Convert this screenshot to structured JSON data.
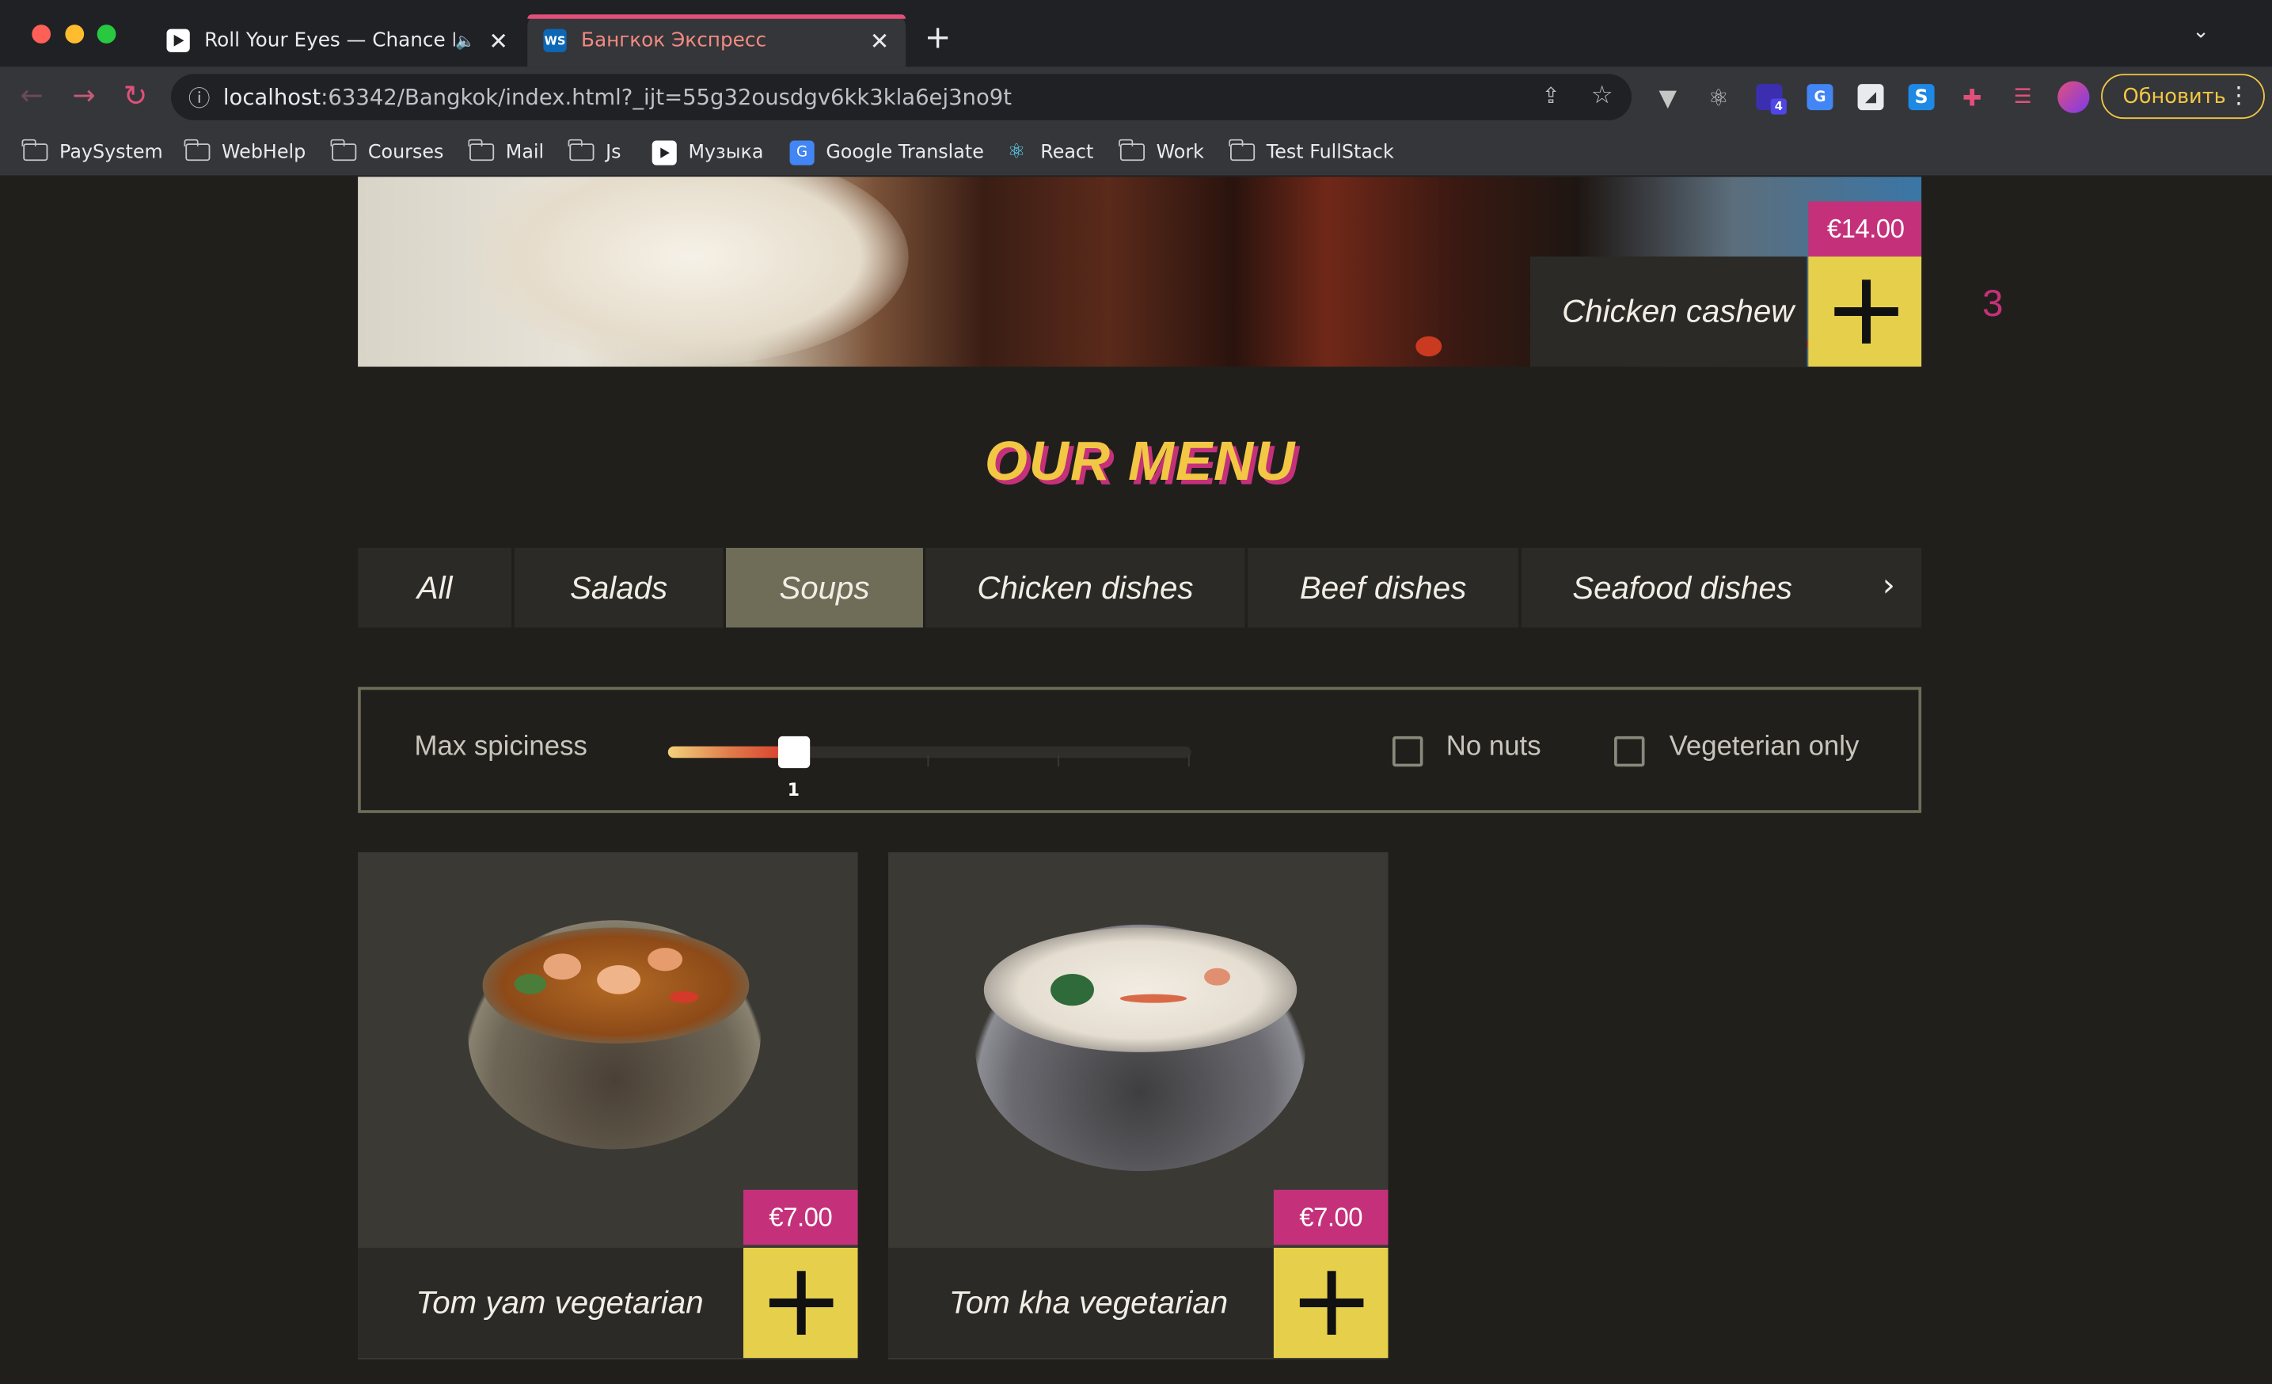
{
  "browser": {
    "tabs": [
      {
        "title": "Roll Your Eyes — Chance P",
        "favicon": "play-icon",
        "audio_icon": "🔈",
        "close": "✕"
      },
      {
        "title": "Бангкок Экспресс",
        "favicon": "webstorm-icon",
        "close": "✕",
        "active": true
      }
    ],
    "new_tab": "+",
    "tabs_dropdown": "⌄",
    "nav": {
      "back": "←",
      "forward": "→",
      "reload": "↻"
    },
    "url": {
      "host": "localhost",
      "rest": ":63342/Bangkok/index.html?_ijt=55g32ousdgv6kk3kla6ej3no9t"
    },
    "omnibox_icons": {
      "info": "ⓘ",
      "share": "⇪",
      "star": "☆"
    },
    "extensions": [
      "vue-devtools-icon",
      "react-devtools-icon",
      "stack-icon",
      "google-translate-icon",
      "eraser-icon",
      "s-extension-icon",
      "puzzle-icon",
      "playlist-icon",
      "avatar-icon"
    ],
    "extension_badge": "4",
    "update_button": "Обновить",
    "menu_dots": "⋮",
    "bookmarks": [
      {
        "label": "PaySystem",
        "icon": "folder-icon"
      },
      {
        "label": "WebHelp",
        "icon": "folder-icon"
      },
      {
        "label": "Courses",
        "icon": "folder-icon"
      },
      {
        "label": "Mail",
        "icon": "folder-icon"
      },
      {
        "label": "Js",
        "icon": "folder-icon"
      },
      {
        "label": "Музыка",
        "icon": "play-icon"
      },
      {
        "label": "Google Translate",
        "icon": "google-translate-icon"
      },
      {
        "label": "React",
        "icon": "react-icon"
      },
      {
        "label": "Work",
        "icon": "folder-icon"
      },
      {
        "label": "Test FullStack",
        "icon": "folder-icon"
      }
    ]
  },
  "hero_card": {
    "name": "Chicken cashew",
    "price": "€14.00",
    "add": "+"
  },
  "cart_count": "3",
  "menu": {
    "title": "OUR MENU",
    "categories": [
      "All",
      "Salads",
      "Soups",
      "Chicken dishes",
      "Beef dishes",
      "Seafood dishes"
    ],
    "active_category": "Soups",
    "next_arrow": "›"
  },
  "filters": {
    "spiciness_label": "Max spiciness",
    "spiciness_value": "1",
    "spiciness_min": 0,
    "spiciness_max": 4,
    "no_nuts_label": "No nuts",
    "no_nuts_checked": false,
    "vegetarian_label": "Vegeterian only",
    "vegetarian_checked": false
  },
  "dishes": [
    {
      "name": "Tom yam vegetarian",
      "price": "€7.00"
    },
    {
      "name": "Tom kha vegetarian",
      "price": "€7.00"
    }
  ],
  "colors": {
    "accent_yellow": "#e6cf4a",
    "accent_magenta": "#c4317a",
    "page_bg": "#211f1c",
    "active_tab": "#6f6c58"
  }
}
